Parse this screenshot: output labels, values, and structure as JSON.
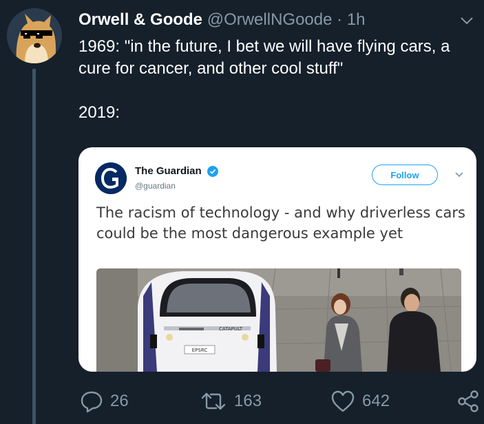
{
  "tweet": {
    "display_name": "Orwell & Goode",
    "handle": "@OrwellNGoode",
    "separator": "·",
    "time": "1h",
    "text_line1": "1969: \"in the future, I bet we will have flying cars, a cure for cancer, and other cool stuff\"",
    "text_line2": "2019:"
  },
  "embedded": {
    "name": "The Guardian",
    "handle": "@guardian",
    "follow_label": "Follow",
    "headline": "The racism of technology - and why driverless cars could be the most dangerous example yet",
    "car_plate": "EPSRC",
    "car_brand": "CATAPULT"
  },
  "actions": {
    "replies": "26",
    "retweets": "163",
    "likes": "642"
  },
  "colors": {
    "background": "#15202b",
    "secondary_text": "#8899a6",
    "accent": "#1da1f2"
  }
}
